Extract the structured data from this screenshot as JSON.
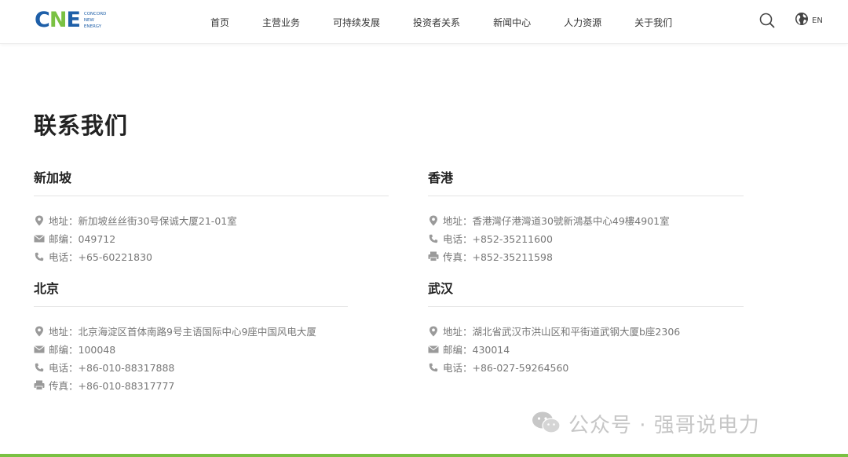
{
  "brand": {
    "mark": [
      "C",
      "N",
      "E"
    ],
    "text_lines": [
      "CONCORD",
      "NEW",
      "ENERGY"
    ]
  },
  "nav": {
    "items": [
      "首页",
      "主营业务",
      "可持续发展",
      "投资者关系",
      "新闻中心",
      "人力资源",
      "关于我们"
    ]
  },
  "header": {
    "search_icon": "search-icon",
    "lang_icon": "globe-icon",
    "lang_label": "EN"
  },
  "page": {
    "title": "联系我们"
  },
  "offices": {
    "singapore": {
      "name": "新加坡",
      "lines": [
        {
          "icon": "location-icon",
          "text": "地址：新加坡丝丝街30号保诚大厦21-01室"
        },
        {
          "icon": "mail-icon",
          "text": "邮编：049712"
        },
        {
          "icon": "phone-icon",
          "text": "电话：+65-60221830"
        }
      ]
    },
    "hongkong": {
      "name": "香港",
      "lines": [
        {
          "icon": "location-icon",
          "text": "地址：香港灣仔港灣道30號新鴻基中心49樓4901室"
        },
        {
          "icon": "phone-icon",
          "text": "电话：+852-35211600"
        },
        {
          "icon": "fax-icon",
          "text": "传真：+852-35211598"
        }
      ]
    },
    "beijing": {
      "name": "北京",
      "lines": [
        {
          "icon": "location-icon",
          "text": "地址：北京海淀区首体南路9号主语国际中心9座中国风电大厦"
        },
        {
          "icon": "mail-icon",
          "text": "邮编：100048"
        },
        {
          "icon": "phone-icon",
          "text": "电话：+86-010-88317888"
        },
        {
          "icon": "fax-icon",
          "text": "传真：+86-010-88317777"
        }
      ]
    },
    "wuhan": {
      "name": "武汉",
      "lines": [
        {
          "icon": "location-icon",
          "text": "地址：湖北省武汉市洪山区和平街道武钢大厦b座2306"
        },
        {
          "icon": "mail-icon",
          "text": "邮编：430014"
        },
        {
          "icon": "phone-icon",
          "text": "电话：+86-027-59264560"
        }
      ]
    }
  },
  "watermark": {
    "icon": "wechat-icon",
    "text": "公众号 · 强哥说电力"
  },
  "colors": {
    "brand_blue": "#1e5fa8",
    "brand_green": "#7ac143",
    "text_dark": "#222222",
    "text_muted": "#777777",
    "icon_gray": "#9a9a9a"
  }
}
